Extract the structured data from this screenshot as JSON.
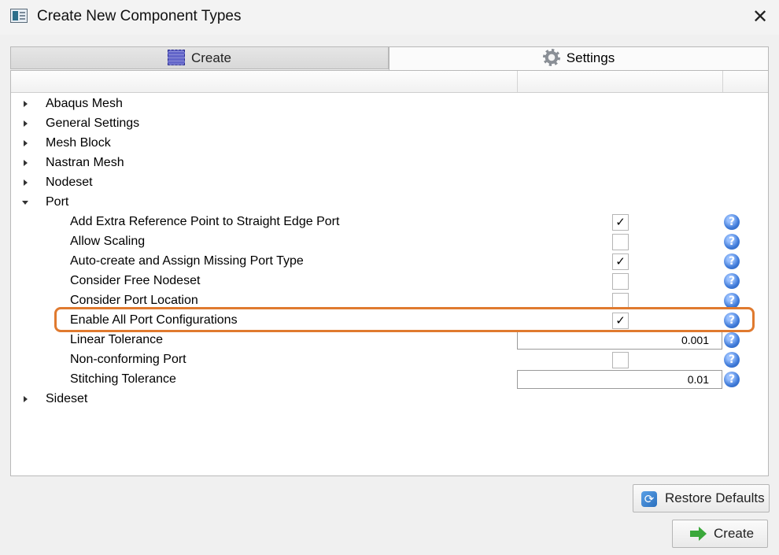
{
  "window": {
    "title": "Create New Component Types",
    "close_glyph": "✕"
  },
  "tabs": [
    {
      "label": "Create",
      "icon": "mesh-cube-icon",
      "active": false
    },
    {
      "label": "Settings",
      "icon": "gear-icon",
      "active": true
    }
  ],
  "tree": {
    "groups_top": [
      {
        "label": "Abaqus Mesh",
        "expanded": false
      },
      {
        "label": "General Settings",
        "expanded": false
      },
      {
        "label": "Mesh Block",
        "expanded": false
      },
      {
        "label": "Nastran Mesh",
        "expanded": false
      },
      {
        "label": "Nodeset",
        "expanded": false
      }
    ],
    "port_group": {
      "label": "Port",
      "expanded": true
    },
    "port_settings": [
      {
        "label": "Add Extra Reference Point to Straight Edge Port",
        "type": "checkbox",
        "checked": true
      },
      {
        "label": "Allow Scaling",
        "type": "checkbox",
        "checked": false
      },
      {
        "label": "Auto-create and Assign Missing Port Type",
        "type": "checkbox",
        "checked": true
      },
      {
        "label": "Consider Free Nodeset",
        "type": "checkbox",
        "checked": false
      },
      {
        "label": "Consider Port Location",
        "type": "checkbox",
        "checked": false
      },
      {
        "label": "Enable All Port Configurations",
        "type": "checkbox",
        "checked": true,
        "highlighted": true
      },
      {
        "label": "Linear Tolerance",
        "type": "number",
        "value": "0.001"
      },
      {
        "label": "Non-conforming Port",
        "type": "checkbox",
        "checked": false
      },
      {
        "label": "Stitching Tolerance",
        "type": "number",
        "value": "0.01"
      }
    ],
    "groups_bottom": [
      {
        "label": "Sideset",
        "expanded": false
      }
    ],
    "check_glyph": "✓",
    "help_glyph": "?"
  },
  "buttons": {
    "restore_defaults": "Restore Defaults",
    "create": "Create"
  },
  "colors": {
    "highlight": "#e07a2f",
    "help_icon": "#3f7ad8",
    "create_arrow": "#3aa83a"
  }
}
